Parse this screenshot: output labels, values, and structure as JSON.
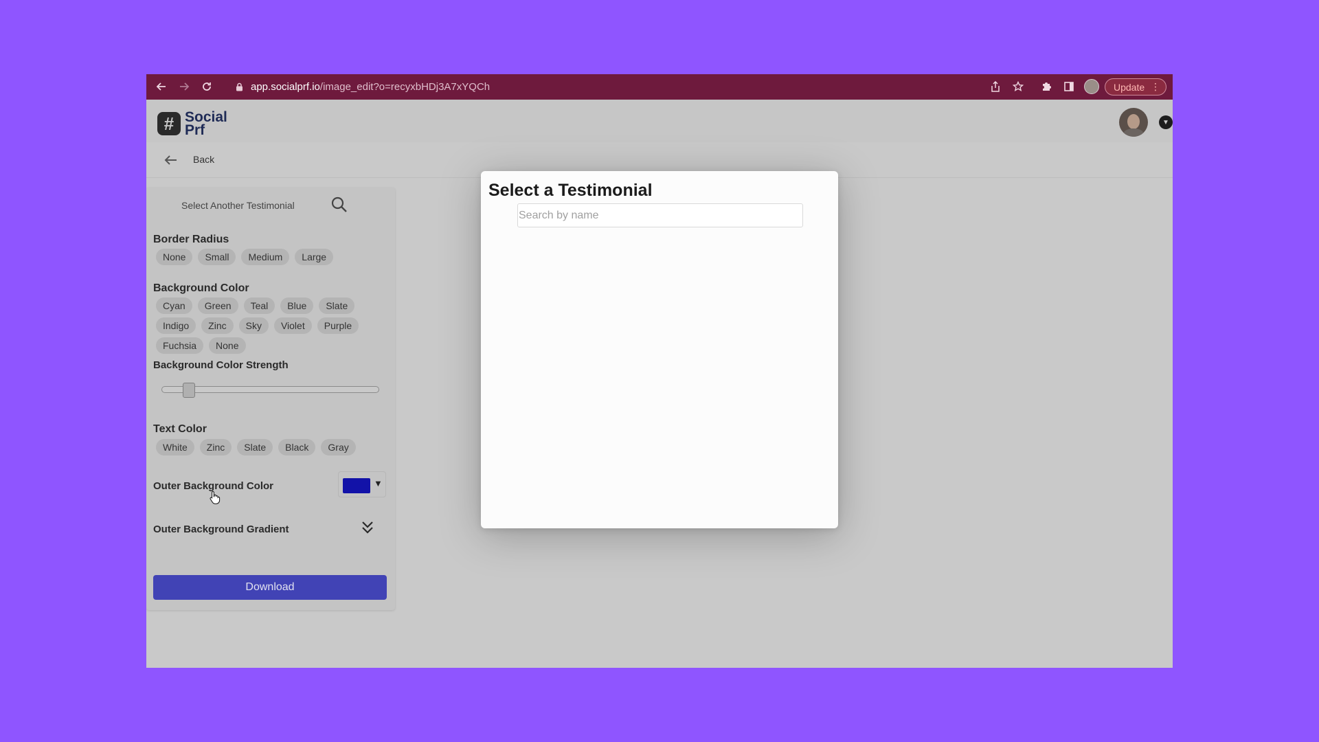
{
  "browser": {
    "url_domain": "app.socialprf.io",
    "url_path": "/image_edit?o=recyxbHDj3A7xYQCh",
    "update_label": "Update",
    "icons": [
      "back-arrow-icon",
      "forward-arrow-icon",
      "reload-icon",
      "lock-icon",
      "share-icon",
      "star-icon",
      "puzzle-icon",
      "sidebar-icon",
      "profile-icon",
      "kebab-menu-icon"
    ]
  },
  "app": {
    "logo_line1": "Social",
    "logo_line2": "Prf",
    "logo_mark": "#",
    "back_label": "Back"
  },
  "panel": {
    "select_another_label": "Select Another Testimonial",
    "border_radius": {
      "title": "Border Radius",
      "options": [
        "None",
        "Small",
        "Medium",
        "Large"
      ]
    },
    "background_color": {
      "title": "Background Color",
      "options_row1": [
        "Cyan",
        "Green",
        "Teal",
        "Blue",
        "Slate"
      ],
      "options_row2": [
        "Indigo",
        "Zinc",
        "Sky",
        "Violet",
        "Purple"
      ],
      "options_row3": [
        "Fuchsia",
        "None"
      ]
    },
    "background_strength": {
      "title": "Background Color Strength",
      "value_fraction": 0.1
    },
    "text_color": {
      "title": "Text Color",
      "options": [
        "White",
        "Zinc",
        "Slate",
        "Black",
        "Gray"
      ]
    },
    "outer_background_color": {
      "title": "Outer Background Color",
      "swatch_color": "#1212a8"
    },
    "outer_background_gradient": {
      "title": "Outer Background Gradient"
    },
    "download_label": "Download"
  },
  "modal": {
    "title": "Select a Testimonial",
    "search_placeholder": "Search by name",
    "search_value": ""
  },
  "colors": {
    "page_background": "#8f55ff",
    "browser_bar": "#6e1a3d",
    "download_button": "#4143b5"
  }
}
